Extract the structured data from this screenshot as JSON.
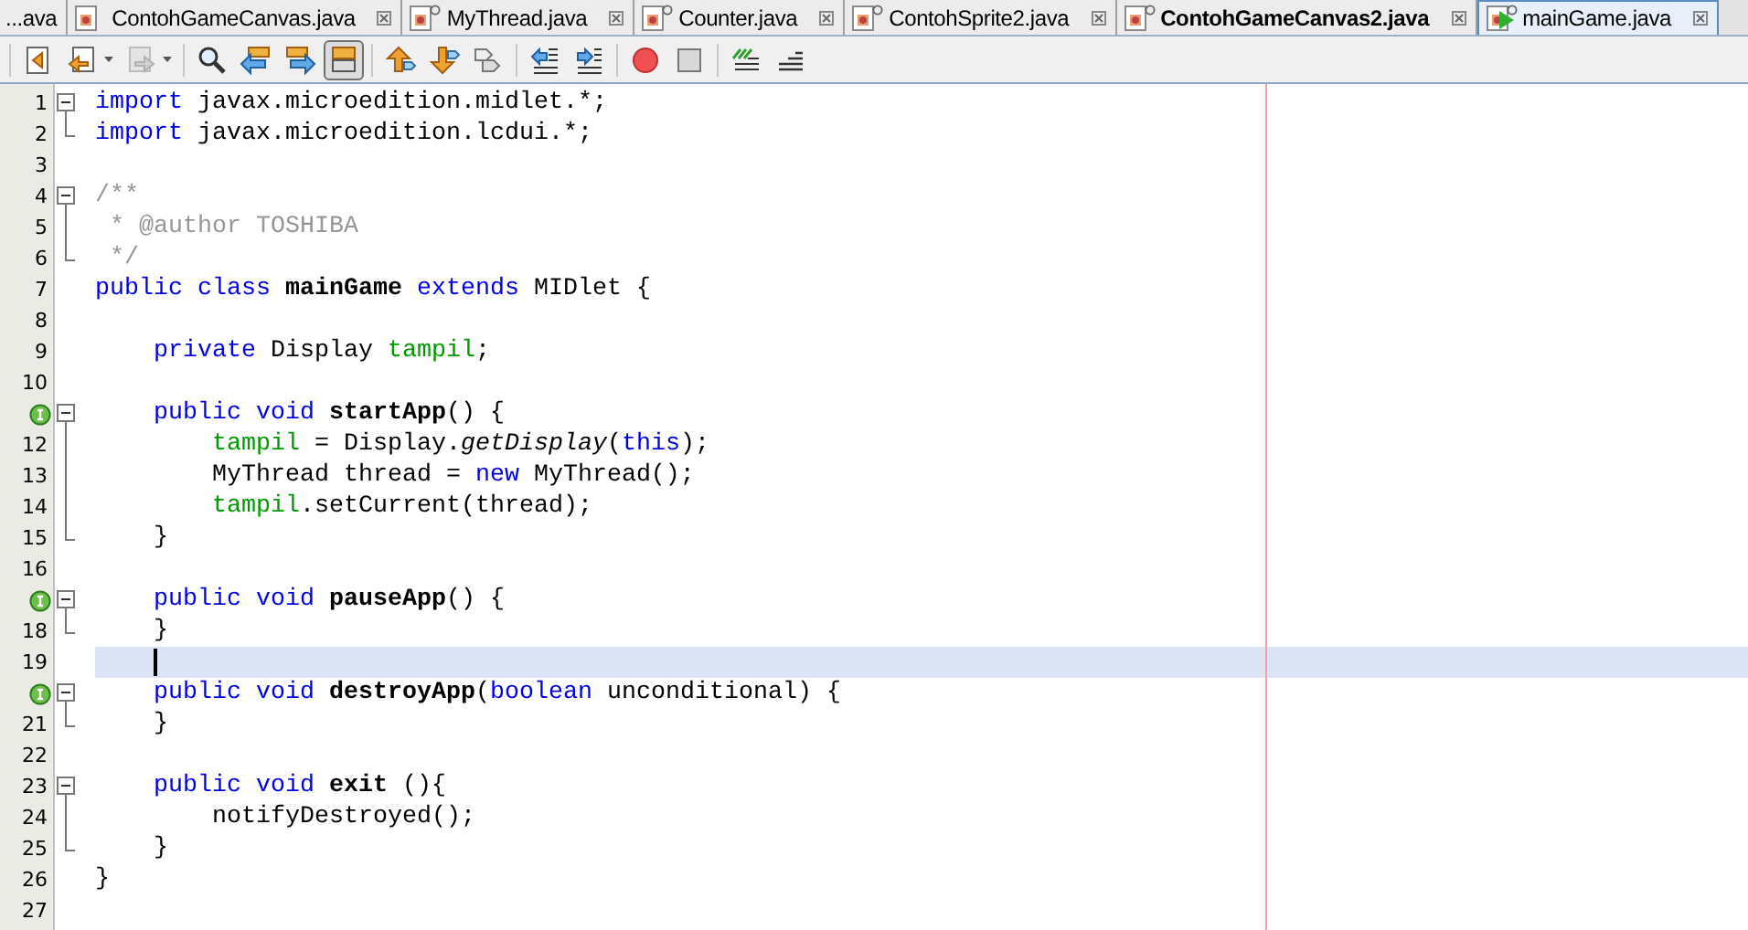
{
  "tabs": [
    {
      "label": "...ava",
      "selected": false,
      "modified": false,
      "icon": false
    },
    {
      "label": "ContohGameCanvas.java",
      "selected": false,
      "modified": false,
      "icon": true,
      "pinned": false
    },
    {
      "label": "MyThread.java",
      "selected": false,
      "modified": false,
      "icon": true,
      "pinned": true
    },
    {
      "label": "Counter.java",
      "selected": false,
      "modified": false,
      "icon": true,
      "pinned": true
    },
    {
      "label": "ContohSprite2.java",
      "selected": false,
      "modified": false,
      "icon": true,
      "pinned": true
    },
    {
      "label": "ContohGameCanvas2.java",
      "selected": false,
      "modified": true,
      "icon": true,
      "pinned": true
    },
    {
      "label": "mainGame.java",
      "selected": true,
      "modified": false,
      "icon": true,
      "pinned": true
    }
  ],
  "toolbar": [
    [
      {
        "kind": "last-edit",
        "pressed": false,
        "disabled": false,
        "dropdown": false
      },
      {
        "kind": "back",
        "pressed": false,
        "disabled": false,
        "dropdown": true
      },
      {
        "kind": "forward",
        "pressed": false,
        "disabled": true,
        "dropdown": true
      }
    ],
    [
      {
        "kind": "find",
        "pressed": false,
        "disabled": false,
        "dropdown": false
      },
      {
        "kind": "find-prev",
        "pressed": false,
        "disabled": false,
        "dropdown": false
      },
      {
        "kind": "find-next",
        "pressed": false,
        "disabled": false,
        "dropdown": false
      },
      {
        "kind": "highlight",
        "pressed": true,
        "disabled": false,
        "dropdown": false
      }
    ],
    [
      {
        "kind": "prev-bookmark",
        "pressed": false,
        "disabled": false,
        "dropdown": false
      },
      {
        "kind": "next-bookmark",
        "pressed": false,
        "disabled": false,
        "dropdown": false
      },
      {
        "kind": "toggle-bookmark",
        "pressed": false,
        "disabled": false,
        "dropdown": false
      }
    ],
    [
      {
        "kind": "shift-left",
        "pressed": false,
        "disabled": false,
        "dropdown": false
      },
      {
        "kind": "shift-right",
        "pressed": false,
        "disabled": false,
        "dropdown": false
      }
    ],
    [
      {
        "kind": "record",
        "pressed": false,
        "disabled": false,
        "dropdown": false
      },
      {
        "kind": "stop",
        "pressed": false,
        "disabled": false,
        "dropdown": false
      }
    ],
    [
      {
        "kind": "comment",
        "pressed": false,
        "disabled": false,
        "dropdown": false
      },
      {
        "kind": "uncomment",
        "pressed": false,
        "disabled": false,
        "dropdown": false
      }
    ]
  ],
  "lines": [
    {
      "number": "1",
      "implements": false,
      "fold_open": true,
      "fold_body": false,
      "fold_end": false,
      "current": false,
      "tokens": [
        {
          "kind": "kw",
          "text": "import"
        },
        {
          "kind": "plain",
          "text": " javax.microedition.midlet.*;"
        }
      ]
    },
    {
      "number": "2",
      "implements": false,
      "fold_open": false,
      "fold_body": false,
      "fold_end": true,
      "current": false,
      "tokens": [
        {
          "kind": "kw",
          "text": "import"
        },
        {
          "kind": "plain",
          "text": " javax.microedition.lcdui.*;"
        }
      ]
    },
    {
      "number": "3",
      "implements": false,
      "fold_open": false,
      "fold_body": false,
      "fold_end": false,
      "current": false
    },
    {
      "number": "4",
      "implements": false,
      "fold_open": true,
      "fold_body": false,
      "fold_end": false,
      "current": false,
      "tokens": [
        {
          "kind": "comment",
          "text": "/**"
        }
      ]
    },
    {
      "number": "5",
      "implements": false,
      "fold_open": false,
      "fold_body": true,
      "fold_end": false,
      "current": false,
      "tokens": [
        {
          "kind": "comment",
          "text": " * @author TOSHIBA"
        }
      ]
    },
    {
      "number": "6",
      "implements": false,
      "fold_open": false,
      "fold_body": false,
      "fold_end": true,
      "current": false,
      "tokens": [
        {
          "kind": "comment",
          "text": " */"
        }
      ]
    },
    {
      "number": "7",
      "implements": false,
      "fold_open": false,
      "fold_body": false,
      "fold_end": false,
      "current": false,
      "tokens": [
        {
          "kind": "kw",
          "text": "public class"
        },
        {
          "kind": "decl",
          "text": " mainGame"
        },
        {
          "kind": "kw",
          "text": " extends"
        },
        {
          "kind": "plain",
          "text": " MIDlet {"
        }
      ]
    },
    {
      "number": "8",
      "implements": false,
      "fold_open": false,
      "fold_body": false,
      "fold_end": false,
      "current": false
    },
    {
      "number": "9",
      "implements": false,
      "fold_open": false,
      "fold_body": false,
      "fold_end": false,
      "current": false,
      "tokens": [
        {
          "kind": "kw",
          "text": "    private"
        },
        {
          "kind": "plain",
          "text": " Display "
        },
        {
          "kind": "field",
          "text": "tampil"
        },
        {
          "kind": "plain",
          "text": ";"
        }
      ]
    },
    {
      "number": "10",
      "implements": false,
      "fold_open": false,
      "fold_body": false,
      "fold_end": false,
      "current": false
    },
    {
      "implements": true,
      "fold_open": true,
      "fold_body": false,
      "fold_end": false,
      "current": false,
      "tokens": [
        {
          "kind": "kw",
          "text": "    public void"
        },
        {
          "kind": "decl",
          "text": " startApp"
        },
        {
          "kind": "plain",
          "text": "() {"
        }
      ]
    },
    {
      "number": "12",
      "implements": false,
      "fold_open": false,
      "fold_body": true,
      "fold_end": false,
      "current": false,
      "tokens": [
        {
          "kind": "field",
          "text": "        tampil"
        },
        {
          "kind": "plain",
          "text": " = Display."
        },
        {
          "kind": "static",
          "text": "getDisplay"
        },
        {
          "kind": "plain",
          "text": "("
        },
        {
          "kind": "kw",
          "text": "this"
        },
        {
          "kind": "plain",
          "text": ");"
        }
      ]
    },
    {
      "number": "13",
      "implements": false,
      "fold_open": false,
      "fold_body": true,
      "fold_end": false,
      "current": false,
      "tokens": [
        {
          "kind": "plain",
          "text": "        MyThread thread = "
        },
        {
          "kind": "kw",
          "text": "new"
        },
        {
          "kind": "plain",
          "text": " MyThread();"
        }
      ]
    },
    {
      "number": "14",
      "implements": false,
      "fold_open": false,
      "fold_body": true,
      "fold_end": false,
      "current": false,
      "tokens": [
        {
          "kind": "field",
          "text": "        tampil"
        },
        {
          "kind": "plain",
          "text": ".setCurrent(thread);"
        }
      ]
    },
    {
      "number": "15",
      "implements": false,
      "fold_open": false,
      "fold_body": false,
      "fold_end": true,
      "current": false,
      "tokens": [
        {
          "kind": "plain",
          "text": "    }"
        }
      ]
    },
    {
      "number": "16",
      "implements": false,
      "fold_open": false,
      "fold_body": false,
      "fold_end": false,
      "current": false
    },
    {
      "implements": true,
      "fold_open": true,
      "fold_body": false,
      "fold_end": false,
      "current": false,
      "tokens": [
        {
          "kind": "kw",
          "text": "    public void"
        },
        {
          "kind": "decl",
          "text": " pauseApp"
        },
        {
          "kind": "plain",
          "text": "() {"
        }
      ]
    },
    {
      "number": "18",
      "implements": false,
      "fold_open": false,
      "fold_body": false,
      "fold_end": true,
      "current": false,
      "tokens": [
        {
          "kind": "plain",
          "text": "    }"
        }
      ]
    },
    {
      "number": "19",
      "implements": false,
      "fold_open": false,
      "fold_body": false,
      "fold_end": false,
      "current": true
    },
    {
      "implements": true,
      "fold_open": true,
      "fold_body": false,
      "fold_end": false,
      "current": false,
      "tokens": [
        {
          "kind": "kw",
          "text": "    public void"
        },
        {
          "kind": "decl",
          "text": " destroyApp"
        },
        {
          "kind": "plain",
          "text": "("
        },
        {
          "kind": "kw",
          "text": "boolean"
        },
        {
          "kind": "plain",
          "text": " unconditional) {"
        }
      ]
    },
    {
      "number": "21",
      "implements": false,
      "fold_open": false,
      "fold_body": false,
      "fold_end": true,
      "current": false,
      "tokens": [
        {
          "kind": "plain",
          "text": "    }"
        }
      ]
    },
    {
      "number": "22",
      "implements": false,
      "fold_open": false,
      "fold_body": false,
      "fold_end": false,
      "current": false
    },
    {
      "number": "23",
      "implements": false,
      "fold_open": true,
      "fold_body": false,
      "fold_end": false,
      "current": false,
      "tokens": [
        {
          "kind": "kw",
          "text": "    public void"
        },
        {
          "kind": "decl",
          "text": " exit"
        },
        {
          "kind": "plain",
          "text": " (){"
        }
      ]
    },
    {
      "number": "24",
      "implements": false,
      "fold_open": false,
      "fold_body": true,
      "fold_end": false,
      "current": false,
      "tokens": [
        {
          "kind": "plain",
          "text": "        notifyDestroyed();"
        }
      ]
    },
    {
      "number": "25",
      "implements": false,
      "fold_open": false,
      "fold_body": false,
      "fold_end": true,
      "current": false,
      "tokens": [
        {
          "kind": "plain",
          "text": "    }"
        }
      ]
    },
    {
      "number": "26",
      "implements": false,
      "fold_open": false,
      "fold_body": false,
      "fold_end": false,
      "current": false,
      "tokens": [
        {
          "kind": "plain",
          "text": "}"
        }
      ]
    },
    {
      "number": "27",
      "implements": false,
      "fold_open": false,
      "fold_body": false,
      "fold_end": false,
      "current": false
    }
  ]
}
